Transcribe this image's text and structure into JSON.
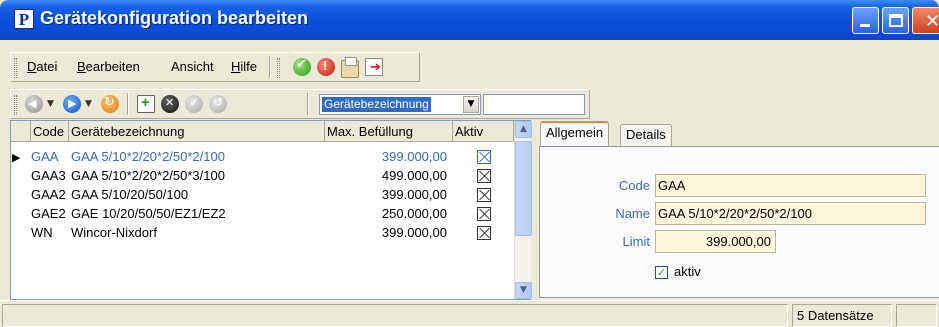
{
  "window": {
    "title": "Gerätekonfiguration bearbeiten",
    "app_icon_letter": "P"
  },
  "menu": [
    {
      "label": "Datei",
      "accel": "D",
      "rest": "atei"
    },
    {
      "label": "Bearbeiten",
      "accel": "B",
      "rest": "earbeiten"
    },
    {
      "label": "Ansicht",
      "accel": "",
      "rest": "Ansicht"
    },
    {
      "label": "Hilfe",
      "accel": "H",
      "rest": "ilfe"
    }
  ],
  "toolbar1": {
    "icons": [
      "save-icon",
      "cancel-icon",
      "print-icon",
      "exit-icon"
    ]
  },
  "toolbar2": {
    "icons": [
      "back-icon",
      "forward-icon",
      "refresh-icon",
      "new-record-icon",
      "delete-record-icon",
      "confirm-icon",
      "undo-icon"
    ],
    "search_field_selected": "Gerätebezeichnung",
    "search_value": ""
  },
  "grid": {
    "columns": [
      "Code",
      "Gerätebezeichnung",
      "Max. Befüllung",
      "Aktiv"
    ],
    "rows": [
      {
        "code": "GAA",
        "name": "GAA 5/10*2/20*2/50*2/100",
        "max": "399.000,00",
        "aktiv": true,
        "selected": true
      },
      {
        "code": "GAA3",
        "name": "GAA 5/10*2/20*2/50*3/100",
        "max": "499.000,00",
        "aktiv": true,
        "selected": false
      },
      {
        "code": "GAA2",
        "name": "GAA 5/10/20/50/100",
        "max": "399.000,00",
        "aktiv": true,
        "selected": false
      },
      {
        "code": "GAE2",
        "name": "GAE 10/20/50/50/EZ1/EZ2",
        "max": "250.000,00",
        "aktiv": true,
        "selected": false
      },
      {
        "code": "WN",
        "name": "Wincor-Nixdorf",
        "max": "399.000,00",
        "aktiv": true,
        "selected": false
      }
    ]
  },
  "tabs": [
    {
      "label": "Allgemein",
      "active": true
    },
    {
      "label": "Details",
      "active": false
    }
  ],
  "detail": {
    "code_label": "Code",
    "code_value": "GAA",
    "name_label": "Name",
    "name_value": "GAA 5/10*2/20*2/50*2/100",
    "limit_label": "Limit",
    "limit_value": "399.000,00",
    "aktiv_label": "aktiv",
    "aktiv_checked": true
  },
  "status": {
    "record_count": "5 Datensätze"
  },
  "colors": {
    "titlebar": "#0a4fd8",
    "selected_text": "#3a6ab0",
    "field_bg": "#fdf8dc",
    "window_bg": "#ece9d8"
  }
}
